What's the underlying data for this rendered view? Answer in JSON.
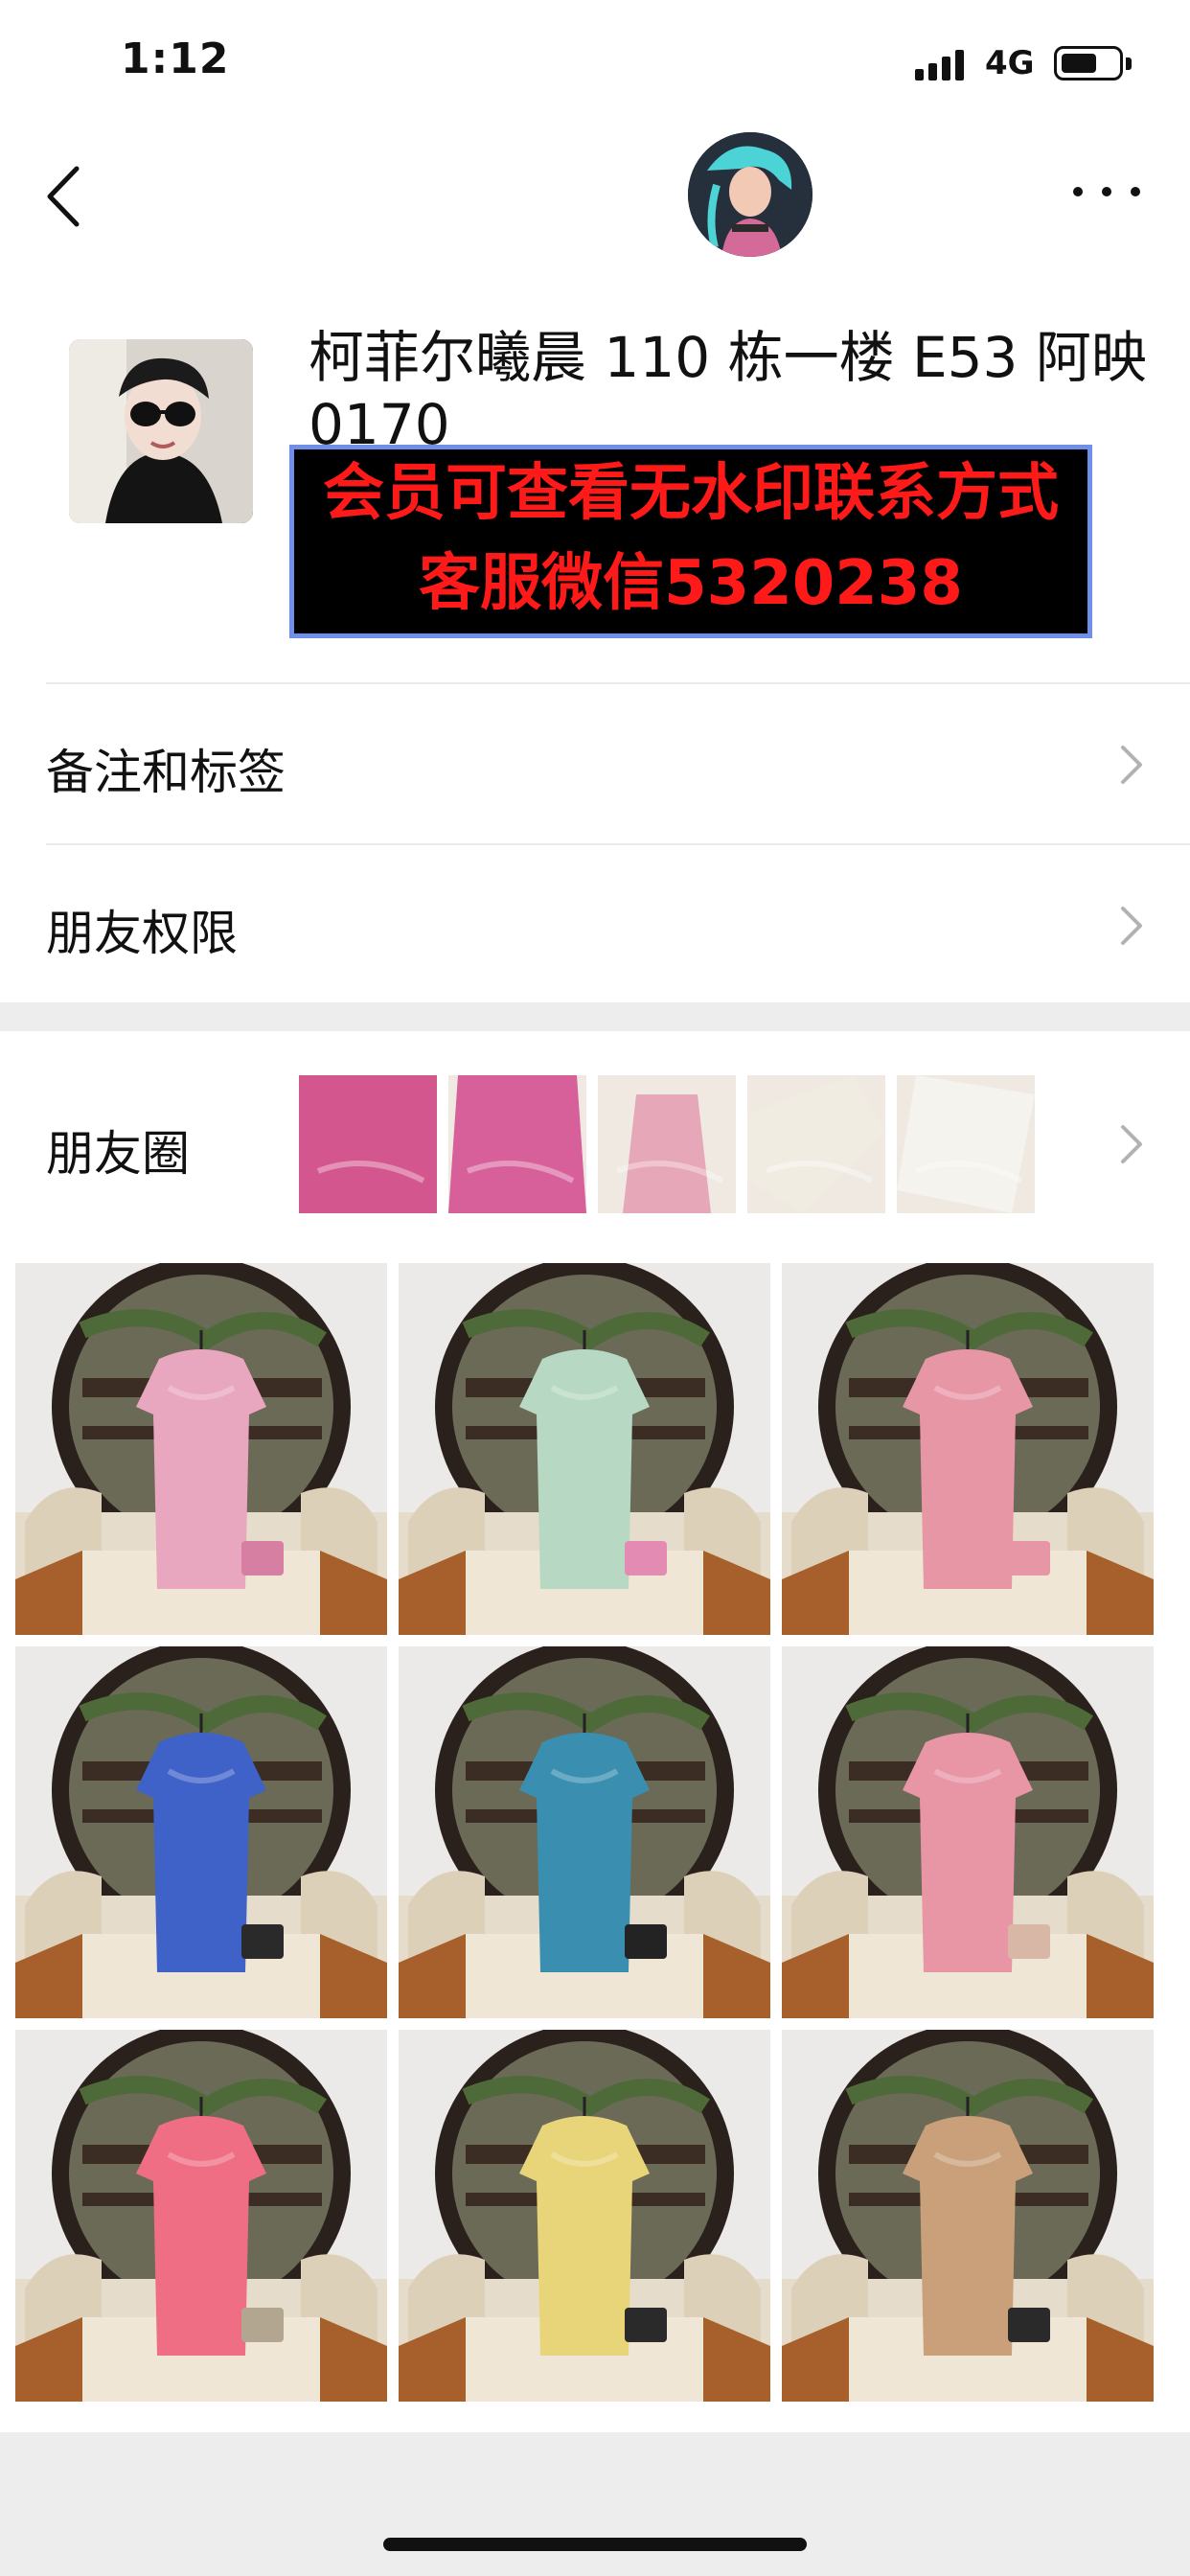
{
  "status_bar": {
    "time": "1:12",
    "network": "4G",
    "battery_level": 0.6
  },
  "nav": {
    "back_icon": "chevron-left-icon",
    "more_icon": "ellipsis-icon"
  },
  "profile": {
    "name": "柯菲尔曦晨 110 栋一楼 E53 阿映 0170",
    "watermark_line_1": "会员可查看无水印联系方式",
    "watermark_line_2": "客服微信5320238"
  },
  "menu": {
    "remarks_label": "备注和标签",
    "permissions_label": "朋友权限"
  },
  "moments": {
    "label": "朋友圈",
    "thumbnail_colors": [
      "#d4568e",
      "#d7609a",
      "#e6a7b9",
      "#f1ece2",
      "#f4f3ee"
    ],
    "photos": [
      {
        "garment": "#e9a6bf",
        "accent": "#d77fa3"
      },
      {
        "garment": "#b7d8c2",
        "accent": "#e48bb4"
      },
      {
        "garment": "#e796a6",
        "accent": "#e796a6"
      },
      {
        "garment": "#3f62c9",
        "accent": "#2a2a2a"
      },
      {
        "garment": "#3a8fb0",
        "accent": "#232323"
      },
      {
        "garment": "#e895a6",
        "accent": "#d8b7a7"
      },
      {
        "garment": "#ef6e84",
        "accent": "#b2a690"
      },
      {
        "garment": "#e8d57a",
        "accent": "#2a2a2a"
      },
      {
        "garment": "#c9a07a",
        "accent": "#2a2a2a"
      }
    ]
  },
  "colors": {
    "watermark_text": "#ff1a1a",
    "watermark_border": "#6f8fe8",
    "section_gap": "#ededed"
  }
}
